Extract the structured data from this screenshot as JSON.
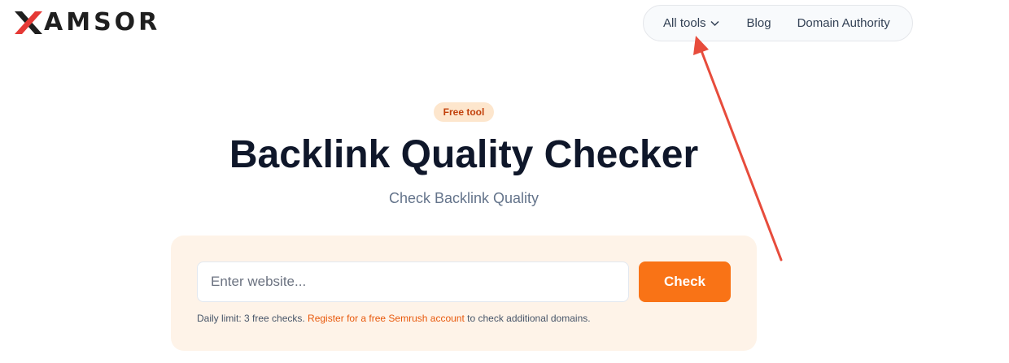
{
  "logo": {
    "text": "AMSOR",
    "full_name": "XAMSOR",
    "accent_color": "#e53935"
  },
  "nav": {
    "items": [
      {
        "label": "All tools",
        "icon": "chevron-down-icon"
      },
      {
        "label": "Blog"
      },
      {
        "label": "Domain Authority"
      }
    ]
  },
  "hero": {
    "badge": "Free tool",
    "title": "Backlink Quality Checker",
    "subtitle": "Check Backlink Quality"
  },
  "form": {
    "input_placeholder": "Enter website...",
    "input_value": "",
    "button_label": "Check",
    "note_prefix": "Daily limit: 3 free checks. ",
    "note_link": "Register for a free Semrush account",
    "note_suffix": " to check additional domains."
  },
  "colors": {
    "accent": "#f97316",
    "badge_bg": "#fde6cd",
    "panel_bg": "#fef3e8",
    "annotation_arrow": "#e74c3c"
  }
}
